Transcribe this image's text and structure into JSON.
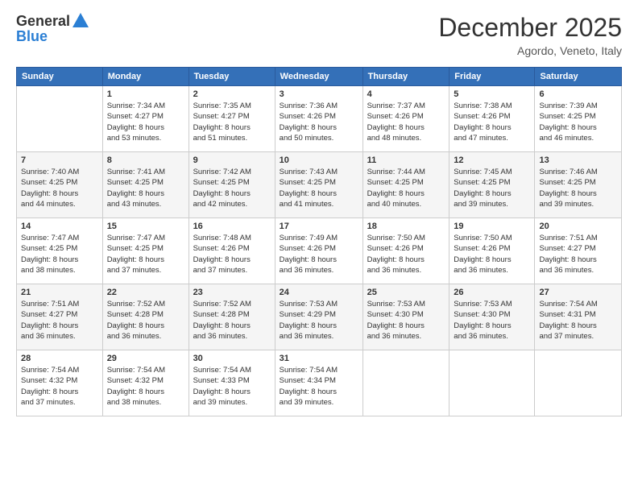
{
  "header": {
    "logo_general": "General",
    "logo_blue": "Blue",
    "month_title": "December 2025",
    "location": "Agordo, Veneto, Italy"
  },
  "days_of_week": [
    "Sunday",
    "Monday",
    "Tuesday",
    "Wednesday",
    "Thursday",
    "Friday",
    "Saturday"
  ],
  "weeks": [
    [
      {
        "day": "",
        "info": ""
      },
      {
        "day": "1",
        "info": "Sunrise: 7:34 AM\nSunset: 4:27 PM\nDaylight: 8 hours\nand 53 minutes."
      },
      {
        "day": "2",
        "info": "Sunrise: 7:35 AM\nSunset: 4:27 PM\nDaylight: 8 hours\nand 51 minutes."
      },
      {
        "day": "3",
        "info": "Sunrise: 7:36 AM\nSunset: 4:26 PM\nDaylight: 8 hours\nand 50 minutes."
      },
      {
        "day": "4",
        "info": "Sunrise: 7:37 AM\nSunset: 4:26 PM\nDaylight: 8 hours\nand 48 minutes."
      },
      {
        "day": "5",
        "info": "Sunrise: 7:38 AM\nSunset: 4:26 PM\nDaylight: 8 hours\nand 47 minutes."
      },
      {
        "day": "6",
        "info": "Sunrise: 7:39 AM\nSunset: 4:25 PM\nDaylight: 8 hours\nand 46 minutes."
      }
    ],
    [
      {
        "day": "7",
        "info": "Sunrise: 7:40 AM\nSunset: 4:25 PM\nDaylight: 8 hours\nand 44 minutes."
      },
      {
        "day": "8",
        "info": "Sunrise: 7:41 AM\nSunset: 4:25 PM\nDaylight: 8 hours\nand 43 minutes."
      },
      {
        "day": "9",
        "info": "Sunrise: 7:42 AM\nSunset: 4:25 PM\nDaylight: 8 hours\nand 42 minutes."
      },
      {
        "day": "10",
        "info": "Sunrise: 7:43 AM\nSunset: 4:25 PM\nDaylight: 8 hours\nand 41 minutes."
      },
      {
        "day": "11",
        "info": "Sunrise: 7:44 AM\nSunset: 4:25 PM\nDaylight: 8 hours\nand 40 minutes."
      },
      {
        "day": "12",
        "info": "Sunrise: 7:45 AM\nSunset: 4:25 PM\nDaylight: 8 hours\nand 39 minutes."
      },
      {
        "day": "13",
        "info": "Sunrise: 7:46 AM\nSunset: 4:25 PM\nDaylight: 8 hours\nand 39 minutes."
      }
    ],
    [
      {
        "day": "14",
        "info": "Sunrise: 7:47 AM\nSunset: 4:25 PM\nDaylight: 8 hours\nand 38 minutes."
      },
      {
        "day": "15",
        "info": "Sunrise: 7:47 AM\nSunset: 4:25 PM\nDaylight: 8 hours\nand 37 minutes."
      },
      {
        "day": "16",
        "info": "Sunrise: 7:48 AM\nSunset: 4:26 PM\nDaylight: 8 hours\nand 37 minutes."
      },
      {
        "day": "17",
        "info": "Sunrise: 7:49 AM\nSunset: 4:26 PM\nDaylight: 8 hours\nand 36 minutes."
      },
      {
        "day": "18",
        "info": "Sunrise: 7:50 AM\nSunset: 4:26 PM\nDaylight: 8 hours\nand 36 minutes."
      },
      {
        "day": "19",
        "info": "Sunrise: 7:50 AM\nSunset: 4:26 PM\nDaylight: 8 hours\nand 36 minutes."
      },
      {
        "day": "20",
        "info": "Sunrise: 7:51 AM\nSunset: 4:27 PM\nDaylight: 8 hours\nand 36 minutes."
      }
    ],
    [
      {
        "day": "21",
        "info": "Sunrise: 7:51 AM\nSunset: 4:27 PM\nDaylight: 8 hours\nand 36 minutes."
      },
      {
        "day": "22",
        "info": "Sunrise: 7:52 AM\nSunset: 4:28 PM\nDaylight: 8 hours\nand 36 minutes."
      },
      {
        "day": "23",
        "info": "Sunrise: 7:52 AM\nSunset: 4:28 PM\nDaylight: 8 hours\nand 36 minutes."
      },
      {
        "day": "24",
        "info": "Sunrise: 7:53 AM\nSunset: 4:29 PM\nDaylight: 8 hours\nand 36 minutes."
      },
      {
        "day": "25",
        "info": "Sunrise: 7:53 AM\nSunset: 4:30 PM\nDaylight: 8 hours\nand 36 minutes."
      },
      {
        "day": "26",
        "info": "Sunrise: 7:53 AM\nSunset: 4:30 PM\nDaylight: 8 hours\nand 36 minutes."
      },
      {
        "day": "27",
        "info": "Sunrise: 7:54 AM\nSunset: 4:31 PM\nDaylight: 8 hours\nand 37 minutes."
      }
    ],
    [
      {
        "day": "28",
        "info": "Sunrise: 7:54 AM\nSunset: 4:32 PM\nDaylight: 8 hours\nand 37 minutes."
      },
      {
        "day": "29",
        "info": "Sunrise: 7:54 AM\nSunset: 4:32 PM\nDaylight: 8 hours\nand 38 minutes."
      },
      {
        "day": "30",
        "info": "Sunrise: 7:54 AM\nSunset: 4:33 PM\nDaylight: 8 hours\nand 39 minutes."
      },
      {
        "day": "31",
        "info": "Sunrise: 7:54 AM\nSunset: 4:34 PM\nDaylight: 8 hours\nand 39 minutes."
      },
      {
        "day": "",
        "info": ""
      },
      {
        "day": "",
        "info": ""
      },
      {
        "day": "",
        "info": ""
      }
    ]
  ]
}
